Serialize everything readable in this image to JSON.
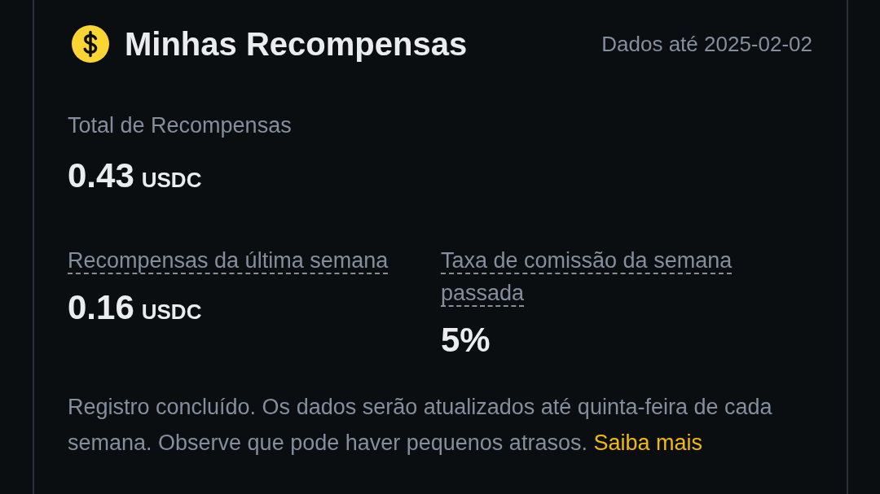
{
  "header": {
    "title": "Minhas Recompensas",
    "data_date": "Dados até 2025-02-02"
  },
  "total": {
    "label": "Total de Recompensas",
    "value": "0.43",
    "unit": "USDC"
  },
  "stats": [
    {
      "label": "Recompensas da última semana",
      "value": "0.16",
      "unit": "USDC"
    },
    {
      "label": "Taxa de comissão da semana passada",
      "value": "5%"
    }
  ],
  "notice": {
    "text": "Registro concluído. Os dados serão atualizados até quinta-feira de cada semana. Observe que pode haver pequenos atrasos.",
    "link": "Saiba mais"
  }
}
